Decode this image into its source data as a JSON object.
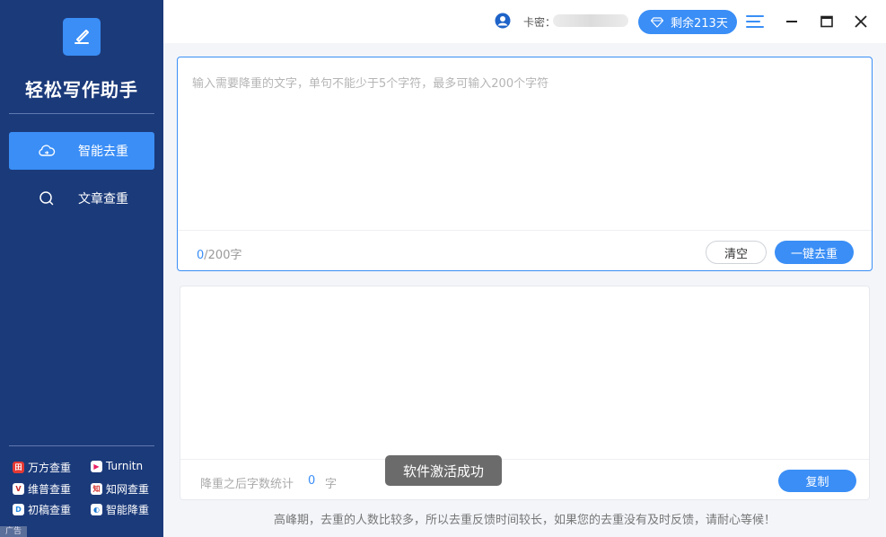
{
  "app": {
    "title": "轻松写作助手"
  },
  "sidebar": {
    "items": [
      {
        "label": "智能去重",
        "icon": "cloud-sync-icon",
        "active": true
      },
      {
        "label": "文章查重",
        "icon": "search-icon",
        "active": false
      }
    ],
    "ads": [
      {
        "label": "万方查重",
        "icon": "wanfang-icon",
        "color": "#e53935"
      },
      {
        "label": "Turnitn",
        "icon": "turnitin-icon",
        "color": "#e91e63"
      },
      {
        "label": "维普查重",
        "icon": "weipu-icon",
        "color": "#c62828"
      },
      {
        "label": "知网查重",
        "icon": "cnki-icon",
        "color": "#d32f2f"
      },
      {
        "label": "初稿查重",
        "icon": "chugao-icon",
        "color": "#1e88e5"
      },
      {
        "label": "智能降重",
        "icon": "smart-reduce-icon",
        "color": "#1976d2"
      }
    ],
    "ad_tag": "广告"
  },
  "topbar": {
    "card_label": "卡密：",
    "remain_label": "剩余213天"
  },
  "input": {
    "placeholder": "输入需要降重的文字，单句不能少于5个字符，最多可输入200个字符",
    "value": "",
    "count": "0",
    "limit": "/200字",
    "clear_label": "清空",
    "dedup_label": "一键去重"
  },
  "output": {
    "stat_label": "降重之后字数统计",
    "stat_count": "0",
    "stat_unit": "字",
    "copy_label": "复制"
  },
  "toast": "软件激活成功",
  "notice": "高峰期，去重的人数比较多，所以去重反馈时间较长，如果您的去重没有及时反馈，请耐心等候！",
  "colors": {
    "sidebar": "#1b3a7a",
    "accent": "#3a8ef6"
  }
}
